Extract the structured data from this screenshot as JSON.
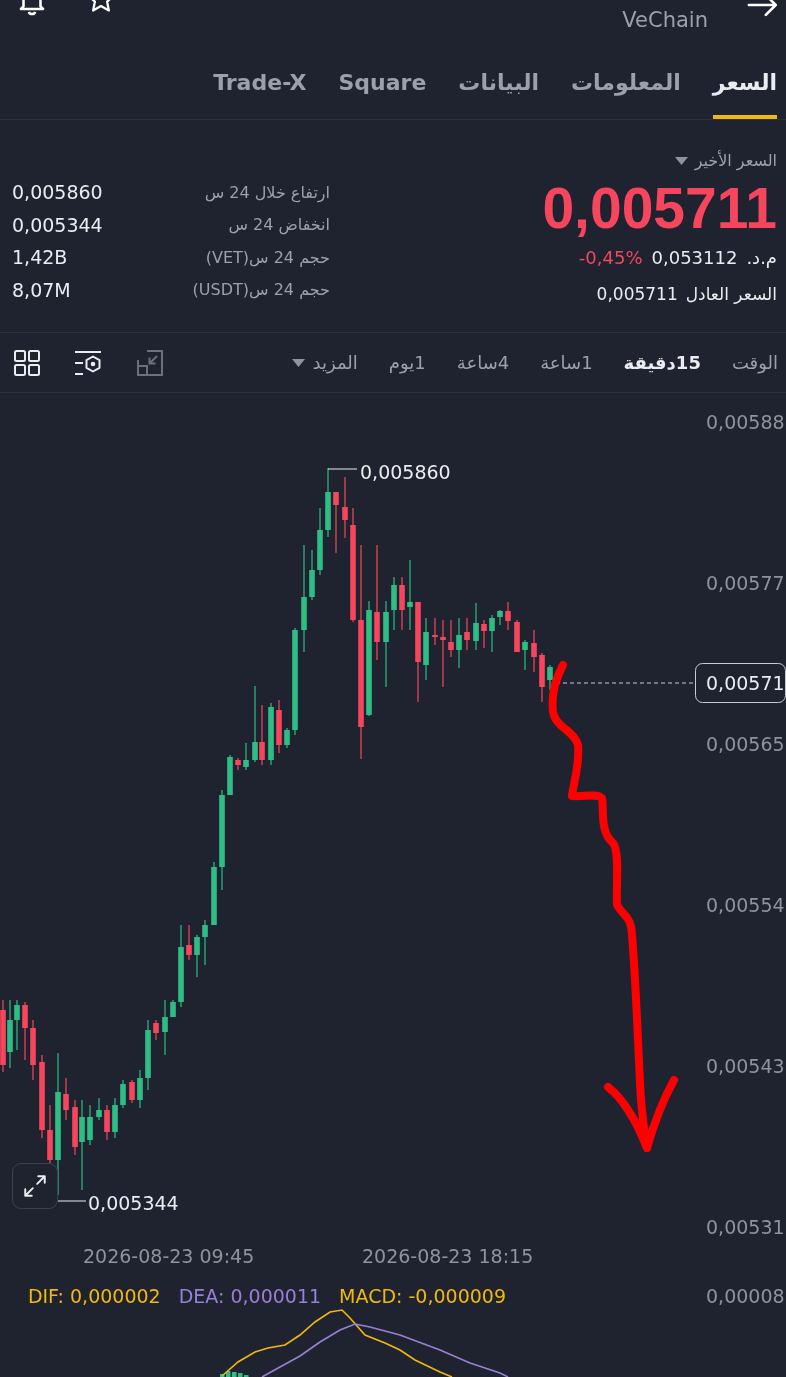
{
  "header": {
    "pair_name": "VeChain"
  },
  "tabs": [
    {
      "label": "السعر",
      "selected": true
    },
    {
      "label": "المعلومات",
      "selected": false
    },
    {
      "label": "البيانات",
      "selected": false
    },
    {
      "label": "Square",
      "selected": false
    },
    {
      "label": "Trade-X",
      "selected": false
    }
  ],
  "price_panel": {
    "dropdown_label": "السعر الأخير",
    "last_price": "0,005711",
    "falling": true,
    "price_unit": "م.د.",
    "converted_price": "0,053112",
    "change": "-0,45%",
    "fair_price_label": "السعر العادل",
    "fair_price": "0,005711"
  },
  "stats": [
    {
      "label": "ارتفاع خلال 24 س",
      "value": "0,005860"
    },
    {
      "label": "انخفاض 24 س",
      "value": "0,005344"
    },
    {
      "label": "حجم 24 س(VET)",
      "value": "1,42B"
    },
    {
      "label": "حجم 24 س(USDT)",
      "value": "8,07M"
    }
  ],
  "intervals": [
    {
      "label": "الوقت",
      "selected": false
    },
    {
      "label": "15دقيقة",
      "selected": true
    },
    {
      "label": "1ساعة",
      "selected": false
    },
    {
      "label": "4ساعة",
      "selected": false
    },
    {
      "label": "1يوم",
      "selected": false
    }
  ],
  "more_menu": {
    "label": "المزيد"
  },
  "chart": {
    "price_axis": [
      "0,00588",
      "0,00577",
      "0,00565",
      "0,00554",
      "0,00543",
      "0,00531"
    ],
    "current_price": "0,00571",
    "high_label": "0,005860",
    "low_label": "0,005344",
    "time_axis": [
      "2026-08-23 18:15",
      "2026-08-23 09:45"
    ]
  },
  "macd": {
    "legend": [
      {
        "label": "MACD: -0,000009",
        "color": "#f0b90b"
      },
      {
        "label": "DEA: 0,000011",
        "color": "#9b7fd4"
      },
      {
        "label": "DIF: 0,000002",
        "color": "#f0b90b"
      }
    ],
    "axis_label": "0,00008"
  }
}
